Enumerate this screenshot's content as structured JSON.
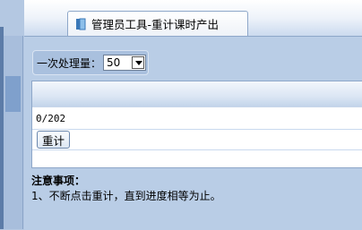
{
  "tab": {
    "title": "管理员工具-重计课时产出",
    "icon": "book-icon"
  },
  "batch": {
    "label": "一次处理量：",
    "selected_value": "50"
  },
  "progress": {
    "text": "0/202"
  },
  "actions": {
    "recount_label": "重计"
  },
  "notes": {
    "title": "注意事项：",
    "line1": "1、不断点击重计，直到进度相等为止。"
  }
}
